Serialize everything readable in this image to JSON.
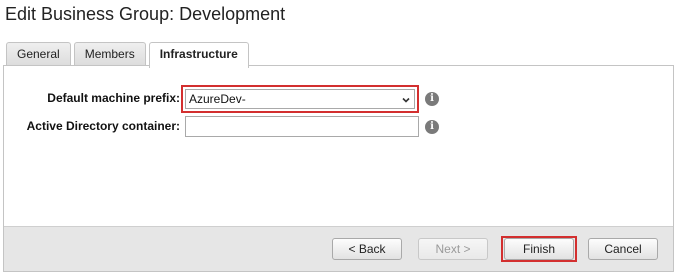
{
  "dialog": {
    "title": "Edit Business Group: Development"
  },
  "tabs": [
    {
      "label": "General",
      "active": false
    },
    {
      "label": "Members",
      "active": false
    },
    {
      "label": "Infrastructure",
      "active": true
    }
  ],
  "form": {
    "machine_prefix": {
      "label": "Default machine prefix:",
      "value": "AzureDev-",
      "icon": "info-icon",
      "info_glyph": "i"
    },
    "ad_container": {
      "label": "Active Directory container:",
      "value": "",
      "icon": "info-icon",
      "info_glyph": "i"
    }
  },
  "footer": {
    "back_label": "< Back",
    "next_label": "Next >",
    "finish_label": "Finish",
    "cancel_label": "Cancel"
  },
  "colors": {
    "highlight": "#d32f2f",
    "footer_bg": "#e6e6e6"
  }
}
